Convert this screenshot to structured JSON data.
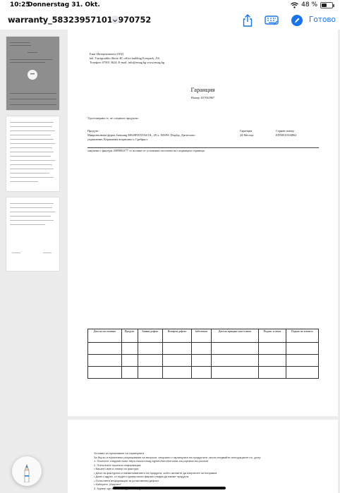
{
  "status_bar": {
    "time": "10:25",
    "date": "Donnerstag 31. Okt.",
    "battery": "48 %",
    "battery_level": 0.48
  },
  "toolbar": {
    "title": "warranty_583239571018970752",
    "done_label": "Готово",
    "accent": "#1a73e8"
  },
  "sidebar": {
    "selected_page": 1,
    "page_count": 3,
    "page1_badge": "•••"
  },
  "page1": {
    "company": "Емаг Интернешънъл ООД",
    "address": "bul. Tsarigradsko Shose 40, office building Evropark, Л.6",
    "contact": "Телефон: 07001 3624; E-mail: info@emag.bg www.emag.bg",
    "title": "Гаранция",
    "number": "Номер: 657063967",
    "certify": "Удостоверява се, че следните продукти:",
    "product_label": "Продукт",
    "product_line1": "Микровълнова фурна Samsung MS28F303TAS/OL, 28 л, 1000W, Display, Дигитално",
    "product_line2": "управление, Керамична вътрешност, Сребрист",
    "warranty_label": "Гаранция",
    "warranty_value": "24 Месеца",
    "serial_label": "Сериен номер",
    "serial_value": "ED50010104862",
    "invoice_note": "закупени с фактура 2005882177 се ползват от условията посочени на следващата страница",
    "table": {
      "headers": [
        "Дата на постъпване",
        "Продукт",
        "Заявен дефект",
        "Номерен дефект",
        "Забележки",
        "Дата на връщане към клиент",
        "Подпис и печат",
        "Подпис на клиента"
      ],
      "rows": [
        [
          "",
          "",
          "",
          "",
          "",
          "",
          "",
          ""
        ],
        [
          "",
          "",
          "",
          "",
          "",
          "",
          "",
          ""
        ],
        [
          "",
          "",
          "",
          "",
          "",
          "",
          "",
          ""
        ]
      ]
    }
  },
  "page2": {
    "lines": [
      "Условия за признаване на гаранцията",
      "За бързо и ефективно разрешаване на въпроси, свързани с гаранцията на продуктите, моля следвайте инструкциите по- долу:",
      "1. Посетете следния линк: https://www.emag.bg/info/form/formular-za-poprsika-na-produkt",
      "2. Попълнете нужната информация:",
      "  • Вашето име и номер на фактура",
      "  • Дата на фактурата и наименованието на продукта, който желаете да изпратите за поправка",
      "  • Дата и адрес, от където куриерската фирма следва да вземе продукта",
      "  • Попълнете информация за установения дефект",
      "  • Изберете „Изпрати\"",
      "3. Куриер ще вземе продукта от адреса, който сте посочили"
    ]
  }
}
